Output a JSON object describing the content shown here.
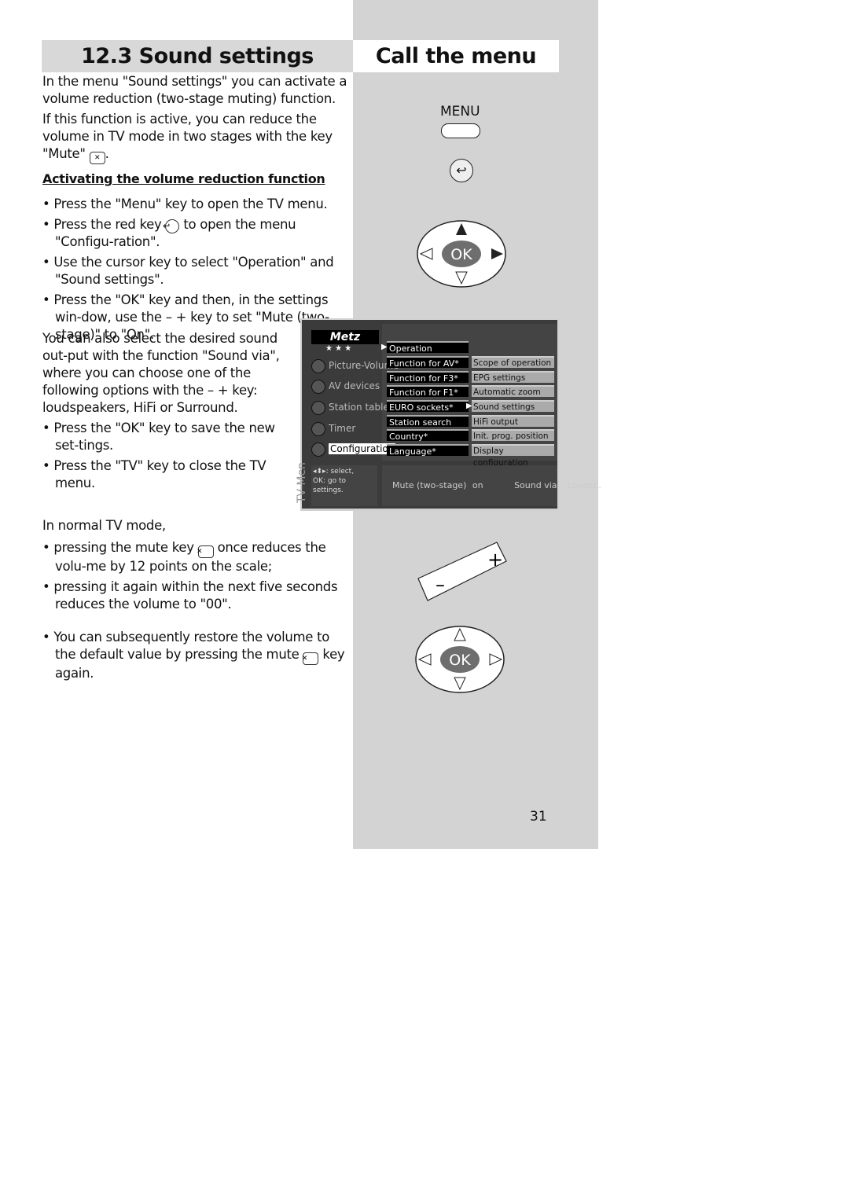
{
  "left_title": "12.3 Sound settings",
  "right_title": "Call the menu",
  "intro": [
    "In the menu \"Sound settings\" you can activate a volume reduction (two-stage muting) function.",
    "If this function is active, you can reduce the volume in TV mode in two stages with the key \"Mute\""
  ],
  "heading": "Activating the volume reduction function",
  "steps": [
    "Press the \"Menu\" key to open the TV menu.",
    "Press the red key",
    "to open the menu \"Configu-ration\".",
    "Use the cursor key to select \"Operation\" and \"Sound settings\".",
    "Press the \"OK\" key and then, in the settings win-dow, use the – + key to set \"Mute (two-stage)\" to \"On\"."
  ],
  "sound_via_text": "You can also select the desired sound out-put with the function \"Sound via\", where you can choose one of the following options with the – + key: loudspeakers, HiFi or Surround.",
  "steps2": [
    "Press the \"OK\" key to save the new set-tings.",
    "Press the \"TV\" key to close the TV menu."
  ],
  "normal_mode": "In normal TV mode,",
  "bullets3": [
    "pressing the mute key",
    "once reduces the volu-me by 12 points on the scale;",
    "pressing it again within the next five seconds reduces the volume to \"00\".",
    "You can subsequently restore the volume to the default value by pressing the mute",
    "key again."
  ],
  "remote": {
    "menu_label": "MENU",
    "ok_label": "OK",
    "plus": "+",
    "minus": "–"
  },
  "tv_menu": {
    "logo": "Metz",
    "stars": "★ ★ ★",
    "side_label": "TV-Men",
    "left_items": [
      "Picture-Volume",
      "AV devices",
      "Station table",
      "Timer",
      "Configuration"
    ],
    "middle_items": [
      "Operation",
      "Function for AV*",
      "Function for F3*",
      "Function for F1*",
      "EURO sockets*",
      "Station search",
      "Country*",
      "Language*"
    ],
    "right_items": [
      "Scope of operation",
      "EPG settings",
      "Automatic zoom",
      "Sound settings",
      "HiFi output",
      "Init. prog. position",
      "Display configuration"
    ],
    "help": [
      "◂⬍▸: select,",
      "OK: go to",
      "settings."
    ],
    "status": {
      "mute_label": "Mute (two-stage)",
      "mute_value": "on",
      "sound_label": "Sound via",
      "sound_value": "Loudsp."
    }
  },
  "page_number": "31"
}
